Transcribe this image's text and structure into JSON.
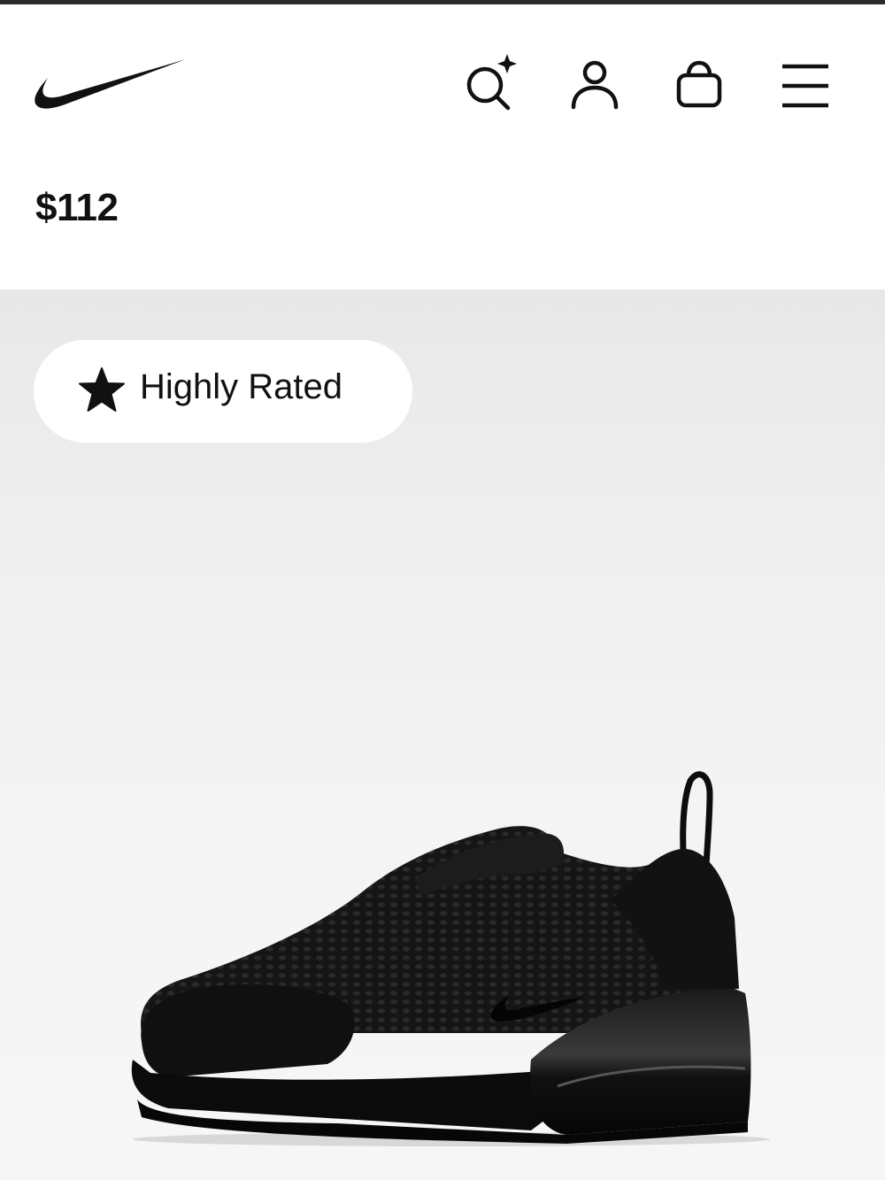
{
  "header": {
    "logo_icon": "swoosh-logo-icon",
    "search_icon": "search-sparkle-icon",
    "account_icon": "user-icon",
    "bag_icon": "bag-icon",
    "menu_icon": "hamburger-menu-icon"
  },
  "product": {
    "price": "$112"
  },
  "hero": {
    "badge_label": "Highly Rated",
    "badge_icon": "star-icon",
    "image": "black-sneaker-product-image"
  },
  "colors": {
    "text": "#111111",
    "hero_background": "#efefef",
    "badge_background": "#ffffff"
  }
}
